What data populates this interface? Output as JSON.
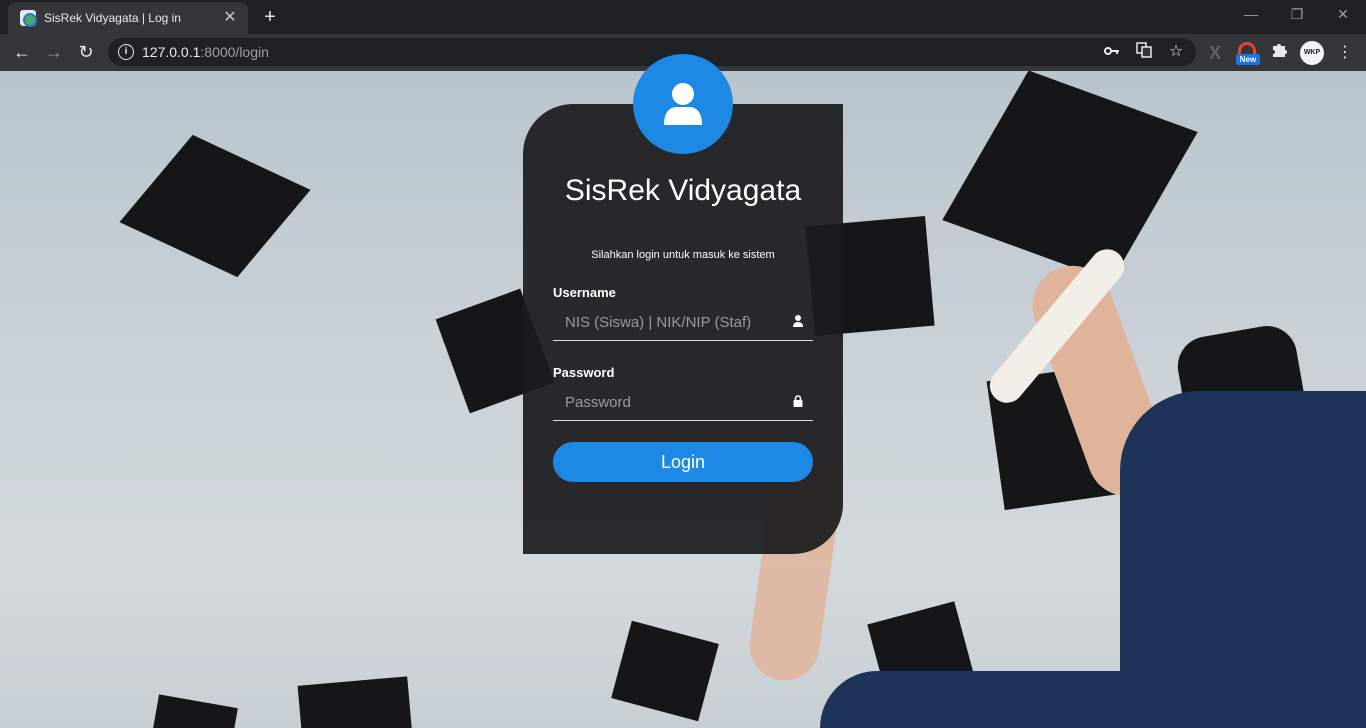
{
  "browser": {
    "tab_title": "SisRek Vidyagata | Log in",
    "tab_close": "✕",
    "new_tab": "+",
    "window_controls": {
      "minimize": "—",
      "maximize": "❐",
      "close": "✕"
    },
    "nav": {
      "back": "←",
      "forward": "→",
      "reload": "↻"
    },
    "url_host": "127.0.0.1",
    "url_path": ":8000/login",
    "extensions": {
      "x_ext": "X",
      "new_badge": "New",
      "profile": "WKP",
      "menu": "⋮"
    }
  },
  "login": {
    "title": "SisRek Vidyagata",
    "subtitle": "Silahkan login untuk masuk ke sistem",
    "username_label": "Username",
    "username_placeholder": "NIS (Siswa) | NIK/NIP (Staf)",
    "password_label": "Password",
    "password_placeholder": "Password",
    "login_button": "Login"
  },
  "colors": {
    "accent": "#1e88e5",
    "card_bg": "#1c1c1e",
    "chrome_dark": "#202124",
    "chrome_toolbar": "#35363a"
  },
  "icons": [
    "favicon-icon",
    "close-icon",
    "plus-icon",
    "back-icon",
    "forward-icon",
    "reload-icon",
    "info-icon",
    "key-icon",
    "translate-icon",
    "star-icon",
    "extension-icon",
    "puzzle-icon",
    "kebab-menu-icon",
    "user-icon",
    "lock-icon"
  ]
}
